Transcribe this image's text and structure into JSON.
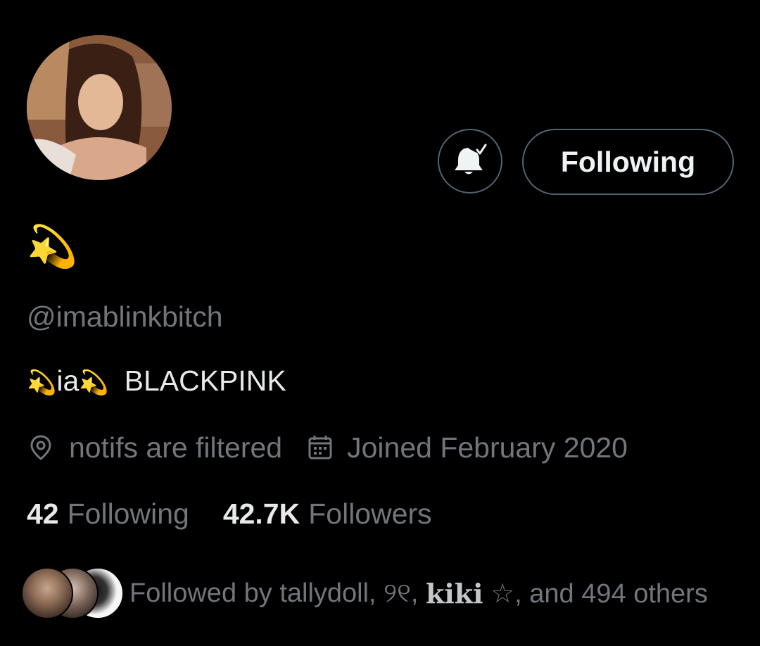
{
  "profile": {
    "display_name": "💫",
    "handle": "@imablinkbitch",
    "bio_emoji_1": "💫",
    "bio_text_1": "ia",
    "bio_emoji_2": "💫",
    "bio_text_2": "BLACKPINK",
    "location": "notifs are filtered",
    "joined": "Joined February 2020"
  },
  "actions": {
    "notifications_icon": "bell-check-icon",
    "follow_label": "Following"
  },
  "stats": {
    "following_count": "42",
    "following_label": "Following",
    "followers_count": "42.7K",
    "followers_label": "Followers"
  },
  "followed_by": {
    "prefix": "Followed by tallydoll, ୨୧,",
    "name_styled": "kiki",
    "suffix": "☆, and 494 others"
  },
  "colors": {
    "background": "#000000",
    "primary_text": "#e7e9ea",
    "secondary_text": "#71767b",
    "border": "#536471"
  }
}
